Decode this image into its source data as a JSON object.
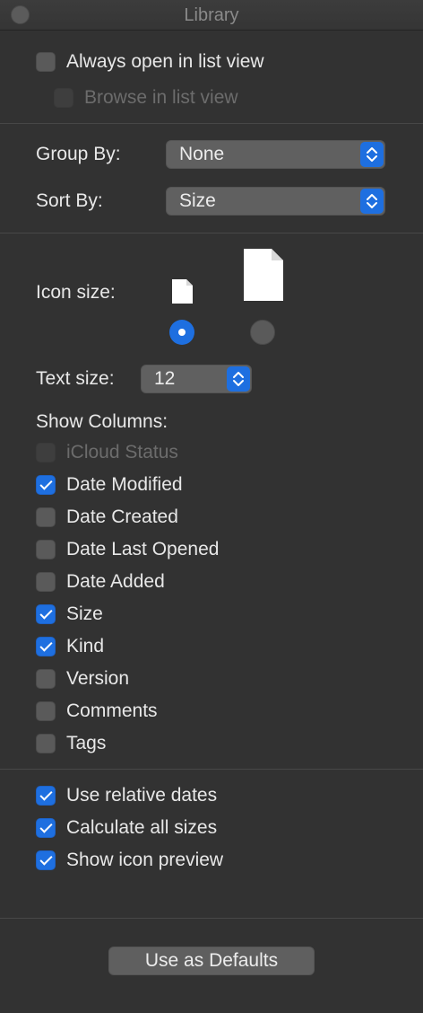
{
  "window": {
    "title": "Library"
  },
  "list_view": [
    {
      "label": "Always open in list view",
      "checked": false,
      "enabled": true
    },
    {
      "label": "Browse in list view",
      "checked": false,
      "enabled": false
    }
  ],
  "group_by": {
    "label": "Group By:",
    "value": "None"
  },
  "sort_by": {
    "label": "Sort By:",
    "value": "Size"
  },
  "icon_size": {
    "label": "Icon size:",
    "options": [
      "small-file-icon",
      "large-file-icon"
    ],
    "selected": 0
  },
  "text_size": {
    "label": "Text size:",
    "value": "12"
  },
  "show_columns": {
    "label": "Show Columns:",
    "items": [
      {
        "label": "iCloud Status",
        "checked": false,
        "enabled": false
      },
      {
        "label": "Date Modified",
        "checked": true,
        "enabled": true
      },
      {
        "label": "Date Created",
        "checked": false,
        "enabled": true
      },
      {
        "label": "Date Last Opened",
        "checked": false,
        "enabled": true
      },
      {
        "label": "Date Added",
        "checked": false,
        "enabled": true
      },
      {
        "label": "Size",
        "checked": true,
        "enabled": true
      },
      {
        "label": "Kind",
        "checked": true,
        "enabled": true
      },
      {
        "label": "Version",
        "checked": false,
        "enabled": true
      },
      {
        "label": "Comments",
        "checked": false,
        "enabled": true
      },
      {
        "label": "Tags",
        "checked": false,
        "enabled": true
      }
    ]
  },
  "options": [
    {
      "label": "Use relative dates",
      "checked": true
    },
    {
      "label": "Calculate all sizes",
      "checked": true
    },
    {
      "label": "Show icon preview",
      "checked": true
    }
  ],
  "defaults_button": {
    "label": "Use as Defaults"
  },
  "colors": {
    "accent": "#1e6fe0",
    "background": "#323232"
  }
}
